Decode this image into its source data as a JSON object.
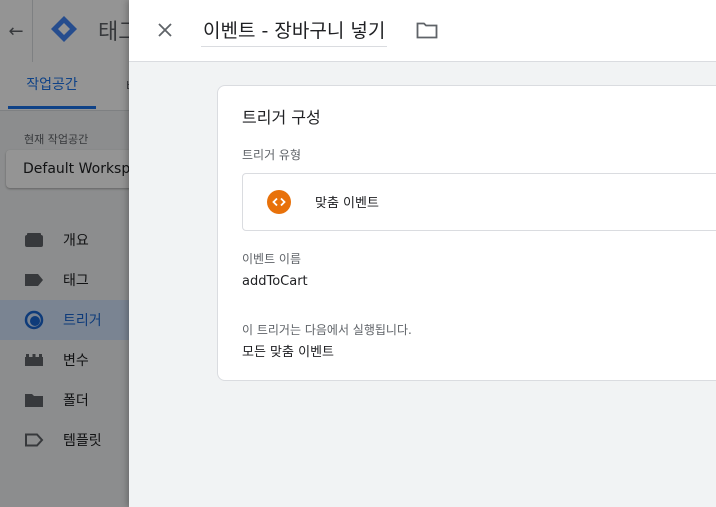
{
  "background": {
    "app_title": "태그",
    "tab_workspace": "작업공간",
    "tab_versions": "버",
    "workspace_label": "현재 작업공간",
    "workspace_name": "Default Workspace",
    "nav": [
      {
        "label": "개요",
        "icon": "overview-icon"
      },
      {
        "label": "태그",
        "icon": "tag-icon"
      },
      {
        "label": "트리거",
        "icon": "trigger-icon",
        "active": true
      },
      {
        "label": "변수",
        "icon": "variable-icon"
      },
      {
        "label": "폴더",
        "icon": "folder-icon"
      },
      {
        "label": "템플릿",
        "icon": "template-icon"
      }
    ]
  },
  "panel": {
    "trigger_name": "이벤트 - 장바구니 넣기",
    "card_title": "트리거 구성",
    "trigger_type_label": "트리거 유형",
    "trigger_type_value": "맞춤 이벤트",
    "event_name_label": "이벤트 이름",
    "event_name_value": "addToCart",
    "fires_on_label": "이 트리거는 다음에서 실행됩니다.",
    "fires_on_value": "모든 맞춤 이벤트"
  },
  "colors": {
    "accent": "#1a73e8",
    "custom_event_icon": "#e8710a",
    "active_nav_bg": "#d2e3fc"
  }
}
